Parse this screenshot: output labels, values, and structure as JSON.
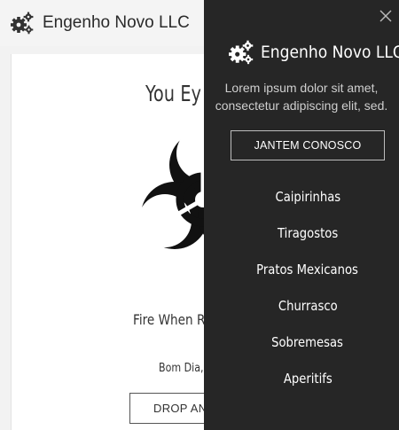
{
  "header": {
    "brand_name": "Engenho Novo LLC",
    "brand_icon": "gears-icon"
  },
  "main": {
    "heading": "You Ey",
    "hero_icon": "biohazard-icon",
    "subheading": "Fire When Re",
    "small_text": "Bom Dia, M",
    "button_label": "DROP AND"
  },
  "drawer": {
    "brand_name": "Engenho Novo LLC",
    "brand_icon": "gears-icon",
    "close_icon": "close-icon",
    "description": "Lorem ipsum dolor sit amet, consectetur adipiscing elit, sed.",
    "cta_label": "JANTEM CONOSCO",
    "menu": [
      {
        "label": "Caipirinhas"
      },
      {
        "label": "Tiragostos"
      },
      {
        "label": "Pratos Mexicanos"
      },
      {
        "label": "Churrasco"
      },
      {
        "label": "Sobremesas"
      },
      {
        "label": "Aperitifs"
      }
    ]
  },
  "colors": {
    "drawer_bg": "#262626",
    "page_bg": "#f2f2f2",
    "text_dark": "#333333"
  }
}
